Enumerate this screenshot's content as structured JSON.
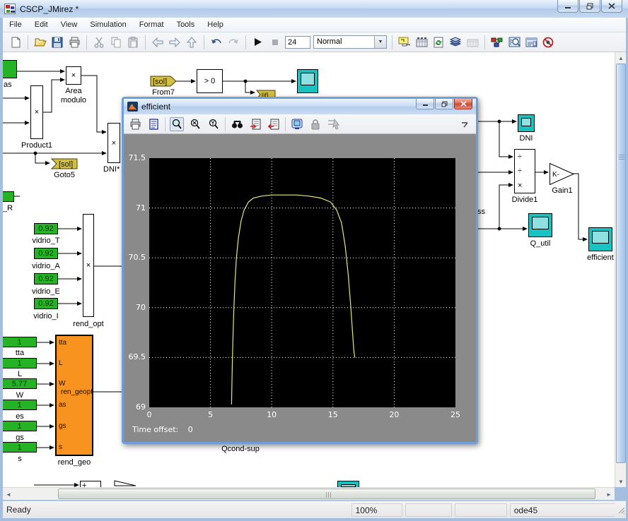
{
  "window": {
    "title": "CSCP_JMirez *"
  },
  "menu": {
    "items": [
      "File",
      "Edit",
      "View",
      "Simulation",
      "Format",
      "Tools",
      "Help"
    ]
  },
  "toolbar": {
    "sim_stop_time": "24",
    "sim_mode": "Normal",
    "icons": [
      "new",
      "open",
      "save",
      "print",
      "cut",
      "copy",
      "paste",
      "back",
      "forward",
      "up",
      "undo",
      "redo",
      "start-simulation",
      "stop-simulation",
      "library-link",
      "model-browser",
      "update-diagram",
      "build",
      "debug-disabled",
      "library-browser",
      "model-explorer",
      "simulink-debugger",
      "highlight-disabled"
    ]
  },
  "status_bar": {
    "state": "Ready",
    "zoom": "100%",
    "solver": "ode45"
  },
  "scope": {
    "title": "efficient",
    "time_offset_label": "Time offset:",
    "time_offset_value": "0",
    "toolbar_icons": [
      "print",
      "parameters",
      "zoom",
      "zoom-x",
      "zoom-y",
      "autoscale",
      "save-axes",
      "restore-axes",
      "floating-scope",
      "lock-axes",
      "signal-selection"
    ]
  },
  "chart_data": {
    "type": "line",
    "title": "",
    "xlabel": "",
    "ylabel": "",
    "xlim": [
      0,
      25
    ],
    "ylim": [
      69,
      71.5
    ],
    "xticks": [
      0,
      5,
      10,
      15,
      20,
      25
    ],
    "yticks": [
      69,
      69.5,
      70,
      70.5,
      71,
      71.5
    ],
    "grid": true,
    "grid_x": [
      5,
      10,
      15,
      20
    ],
    "grid_y": [
      69.5,
      70,
      70.5,
      71
    ],
    "legend": null,
    "background": "#000000",
    "grid_color": "#ffffff",
    "line_color": "#e8e878",
    "series": [
      {
        "name": "efficient",
        "x": [
          6.72,
          6.76,
          6.82,
          6.9,
          7.0,
          7.12,
          7.28,
          7.5,
          7.75,
          8.1,
          8.5,
          9.2,
          10,
          11,
          12,
          13,
          14,
          14.8,
          15.3,
          15.7,
          16.0,
          16.25,
          16.45,
          16.6,
          16.7,
          16.78
        ],
        "y": [
          69.03,
          69.3,
          69.62,
          69.95,
          70.25,
          70.5,
          70.7,
          70.87,
          70.98,
          71.06,
          71.1,
          71.12,
          71.13,
          71.13,
          71.13,
          71.12,
          71.1,
          71.06,
          70.98,
          70.85,
          70.62,
          70.33,
          70.02,
          69.75,
          69.58,
          69.5
        ]
      }
    ]
  },
  "blocks": {
    "mas": {
      "label": "as"
    },
    "product1": {
      "label": "Product1",
      "symbol": "×"
    },
    "area_modulo": {
      "line1": "Area",
      "line2": "modulo",
      "symbol": "×"
    },
    "goto5": {
      "tag": "[sol]",
      "label": "Goto5"
    },
    "from7": {
      "tag": "[sol]",
      "label": "From7"
    },
    "compare": {
      "text": "> 0"
    },
    "if_tag": {
      "tag": "[if]"
    },
    "dni_mult": {
      "label": "DNI*",
      "symbol": "×"
    },
    "t_r": {
      "label": "_R"
    },
    "vidrio": {
      "values": [
        "0.92",
        "0.92",
        "0.92",
        "0.92"
      ],
      "labels": [
        "vidrio_T",
        "vidrio_A",
        "vidrio_E",
        "vidrio_I"
      ]
    },
    "rend_opt": {
      "label": "rend_opt",
      "symbol": "×"
    },
    "geo_consts": {
      "values": [
        "1",
        "1",
        "5.77",
        "1",
        "1",
        "1"
      ],
      "labels": [
        "tta",
        "L",
        "W",
        "es",
        "gs",
        "s"
      ]
    },
    "rend_geo": {
      "ports": [
        "tta",
        "L",
        "W",
        "as",
        "gs",
        "s"
      ],
      "inner_text": "ren_geopt",
      "label": "rend_geo"
    },
    "qcond_sup": {
      "label": "Qcond-sup"
    },
    "sum": {
      "symbol": "+"
    },
    "dni_scope": {
      "label": "DNI"
    },
    "divide1": {
      "label": "Divide1",
      "symbols": [
        "÷",
        "÷",
        "×"
      ]
    },
    "gain1": {
      "text": "K-",
      "label": "Gain1"
    },
    "q_util": {
      "label": "Q_util"
    },
    "efficient_scope": {
      "label": "efficient"
    },
    "ss_fragment": {
      "label": "ss"
    }
  }
}
